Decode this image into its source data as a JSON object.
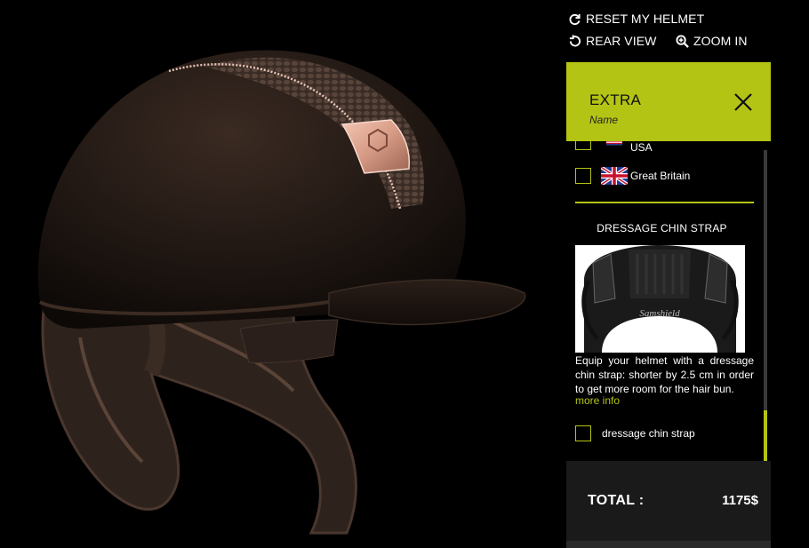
{
  "toolbar": {
    "reset_label": "RESET MY HELMET",
    "rear_label": "REAR VIEW",
    "zoom_label": "ZOOM IN"
  },
  "panel": {
    "title": "EXTRA",
    "subtitle": "Name",
    "countries": [
      {
        "label": "USA",
        "checked": false
      },
      {
        "label": "Great Britain",
        "checked": false
      }
    ],
    "section_title": "DRESSAGE CHIN STRAP",
    "image_brand": "Samshield",
    "description": "Equip your helmet with a dressage chin strap: shorter by 2.5 cm in order to get more room for the hair bun.",
    "more_info": "more info",
    "option_label": "dressage chin strap"
  },
  "total": {
    "label": "TOTAL :",
    "value": "1175$"
  },
  "colors": {
    "accent": "#b4c414",
    "background": "#000000",
    "total_bar": "#1a1a1a"
  }
}
